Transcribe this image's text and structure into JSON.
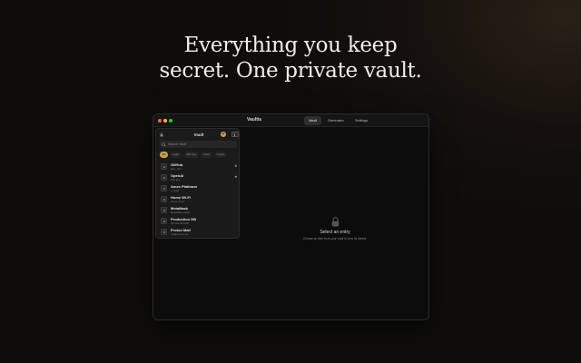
{
  "hero": {
    "line1": "Everything you keep",
    "line2": "secret. One private vault."
  },
  "window": {
    "app_title": "Vaultis",
    "tabs": [
      {
        "label": "Vault",
        "active": true
      },
      {
        "label": "Generator",
        "active": false
      },
      {
        "label": "Settings",
        "active": false
      }
    ]
  },
  "sidebar": {
    "title": "Vault",
    "add_label": "+",
    "search_placeholder": "Search Vault",
    "filters": [
      {
        "label": "All",
        "active": true
      },
      {
        "label": "Login",
        "active": false
      },
      {
        "label": "API Key",
        "active": false
      },
      {
        "label": "Card",
        "active": false
      },
      {
        "label": "Crypto",
        "active": false
      }
    ],
    "items": [
      {
        "name": "GitHub",
        "sub": "john_doe",
        "starred": true
      },
      {
        "name": "OpenAI",
        "sub": "Ops key",
        "starred": true
      },
      {
        "name": "Amex Platinum",
        "sub": "•• 1006",
        "starred": false
      },
      {
        "name": "Home Wi-Fi",
        "sub": "Home Wi-Fi",
        "starred": false
      },
      {
        "name": "MetaMask",
        "sub": "MetaMask wallet",
        "starred": false
      },
      {
        "name": "Production DB",
        "sub": "db.internal:5432",
        "starred": false
      },
      {
        "name": "Proton Mail",
        "sub": "me@proton.me",
        "starred": false
      }
    ],
    "star_glyph": "★"
  },
  "detail": {
    "empty_title": "Select an entry",
    "empty_desc": "Choose an item from your vault to view its details."
  },
  "colors": {
    "accent": "#c9a24a",
    "background": "#0e0d0c"
  }
}
